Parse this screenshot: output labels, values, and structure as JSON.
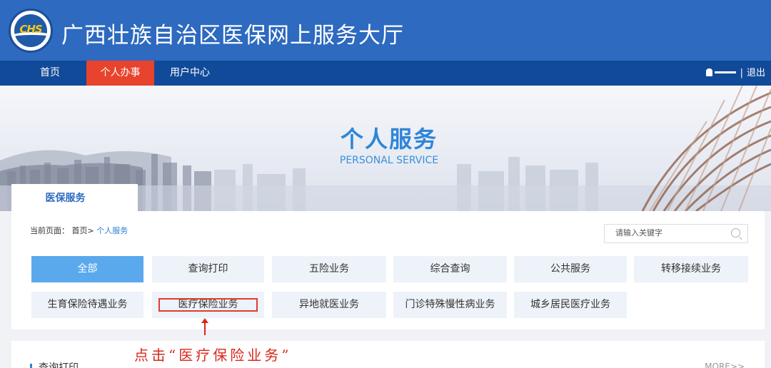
{
  "header": {
    "logo_text": "CHS",
    "title": "广西壮族自治区医保网上服务大厅"
  },
  "nav": {
    "home": "首页",
    "personal": "个人办事",
    "user_center": "用户中心",
    "separator": "|",
    "logout": "退出"
  },
  "banner": {
    "title": "个人服务",
    "subtitle": "PERSONAL SERVICE"
  },
  "tab": {
    "label": "医保服务"
  },
  "breadcrumb": {
    "prefix": "当前页面：",
    "home": "首页",
    "arrow": ">",
    "current": "个人服务"
  },
  "search": {
    "placeholder": "请输入关键字"
  },
  "categories": [
    "全部",
    "查询打印",
    "五险业务",
    "综合查询",
    "公共服务",
    "转移接续业务",
    "生育保险待遇业务",
    "医疗保险业务",
    "异地就医业务",
    "门诊特殊慢性病业务",
    "城乡居民医疗业务"
  ],
  "annotation": {
    "text": "点击“医疗保险业务”"
  },
  "section": {
    "title": "查询打印",
    "more": "MORE>>"
  },
  "colors": {
    "header_blue": "#2d6ac0",
    "nav_blue": "#114a99",
    "nav_active": "#e8432d",
    "active_category": "#5aa9ec",
    "annotation_red": "#d9281c"
  }
}
